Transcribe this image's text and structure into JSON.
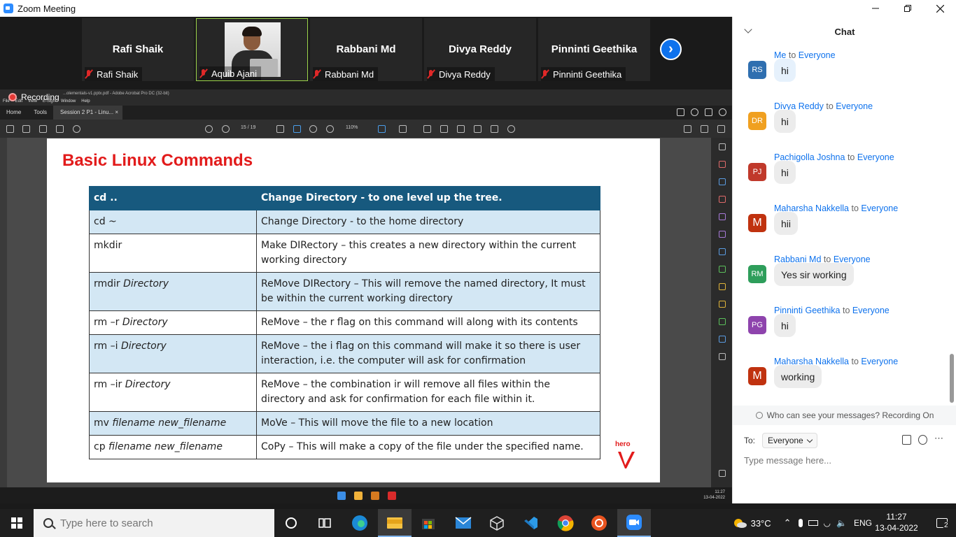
{
  "window": {
    "title": "Zoom Meeting"
  },
  "participants": [
    {
      "display_name": "Rafi Shaik",
      "label": "Rafi Shaik"
    },
    {
      "display_name": "",
      "label": "Aquib Ajani"
    },
    {
      "display_name": "Rabbani Md",
      "label": "Rabbani Md"
    },
    {
      "display_name": "Divya Reddy",
      "label": "Divya Reddy"
    },
    {
      "display_name": "Pinninti Geethika",
      "label": "Pinninti Geethika"
    }
  ],
  "recording": {
    "label": "Recording"
  },
  "acrobat": {
    "title": "...olementals-v1.pptx.pdf - Adobe Acrobat Pro DC (32-bit)",
    "menu": [
      "File",
      "Edit",
      "View",
      "E-Sign",
      "Window",
      "Help"
    ],
    "tabs": {
      "home": "Home",
      "tools": "Tools",
      "document": "Session 2 P1 - Linu..."
    },
    "page_indicator": "15 / 19",
    "zoom": "110%"
  },
  "slide": {
    "title": "Basic Linux Commands",
    "header": {
      "cmd": "cd ..",
      "desc": "Change Directory - to one level up the tree."
    },
    "rows": [
      {
        "cmd": "cd ~",
        "arg": "",
        "desc": "Change Directory - to the home directory"
      },
      {
        "cmd": "mkdir",
        "arg": "",
        "desc": "Make DIRectory – this creates a new directory within the current working directory"
      },
      {
        "cmd": "rmdir ",
        "arg": "Directory",
        "desc": "ReMove DIRectory – This will remove the named directory, It must be within the current working directory"
      },
      {
        "cmd": "rm –r ",
        "arg": "Directory",
        "desc": "ReMove – the r flag on this command will along with its contents"
      },
      {
        "cmd": "rm –i ",
        "arg": "Directory",
        "desc": "ReMove – the i flag on this command will make it so there is user interaction, i.e. the computer will ask for confirmation"
      },
      {
        "cmd": "rm –ir ",
        "arg": "Directory",
        "desc": "ReMove – the combination ir will remove all files within the directory and ask for confirmation for each file within it."
      },
      {
        "cmd": "mv ",
        "arg": "filename new_filename",
        "desc": "MoVe – This will move the file to a new location"
      },
      {
        "cmd": "cp ",
        "arg": "filename new_filename",
        "desc": "CoPy – This will make a copy of the file under the specified name."
      }
    ],
    "logo_text": "hero"
  },
  "inner_clock": {
    "time": "11:27",
    "date": "13-04-2022"
  },
  "chat": {
    "title": "Chat",
    "messages": [
      {
        "sender": "Me",
        "to": "to",
        "recipient": "Everyone",
        "initials": "RS",
        "color": "#2f6fb0",
        "text": "hi",
        "self": true
      },
      {
        "sender": "Divya Reddy",
        "to": "to",
        "recipient": "Everyone",
        "initials": "DR",
        "color": "#f0a020",
        "text": "hi"
      },
      {
        "sender": "Pachigolla Joshna",
        "to": "to",
        "recipient": "Everyone",
        "initials": "PJ",
        "color": "#c0392b",
        "text": "hi"
      },
      {
        "sender": "Maharsha Nakkella",
        "to": "to",
        "recipient": "Everyone",
        "initials": "M",
        "color": "#c0320f",
        "text": "hii"
      },
      {
        "sender": "Rabbani Md",
        "to": "to",
        "recipient": "Everyone",
        "initials": "RM",
        "color": "#2e9e5b",
        "text": "Yes sir working"
      },
      {
        "sender": "Pinninti Geethika",
        "to": "to",
        "recipient": "Everyone",
        "initials": "PG",
        "color": "#8e44ad",
        "text": "hi"
      },
      {
        "sender": "Maharsha Nakkella",
        "to": "to",
        "recipient": "Everyone",
        "initials": "M",
        "color": "#c0320f",
        "text": "working"
      }
    ],
    "privacy_notice": "Who can see your messages? Recording On",
    "to_label": "To:",
    "to_value": "Everyone",
    "input_placeholder": "Type message here..."
  },
  "taskbar": {
    "search_placeholder": "Type here to search",
    "weather": "33°C",
    "language": "ENG",
    "time": "11:27",
    "date": "13-04-2022",
    "notifications": "2"
  }
}
